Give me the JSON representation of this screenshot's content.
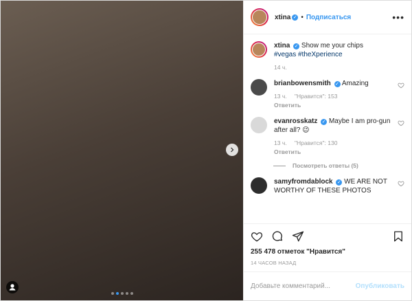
{
  "header": {
    "username": "xtina",
    "follow_label": "Подписаться",
    "separator": "•",
    "more_label": "•••"
  },
  "media": {
    "note": "",
    "slide_count": 5,
    "active_slide": 2
  },
  "caption": {
    "username": "xtina",
    "text": "Show me your chips",
    "hashtags": "#vegas #theXperience",
    "time": "14 ч."
  },
  "comments": [
    {
      "username": "brianbowensmith",
      "verified": true,
      "text": "Amazing",
      "time": "13 ч.",
      "likes": "\"Нравится\": 153",
      "reply_label": "Ответить"
    },
    {
      "username": "evanrosskatz",
      "verified": true,
      "text": "Maybe I am pro-gun after all? 😉",
      "time": "13 ч.",
      "likes": "\"Нравится\": 130",
      "reply_label": "Ответить"
    },
    {
      "username": "samyfromdablock",
      "verified": true,
      "text": "WE ARE NOT WORTHY OF THESE PHOTOS",
      "time": "",
      "likes": "",
      "reply_label": ""
    }
  ],
  "view_replies": "Посмотреть ответы (5)",
  "likes_text": "255 478 отметок \"Нравится\"",
  "posted_time": "14 ЧАСОВ НАЗАД",
  "add_comment": {
    "placeholder": "Добавьте комментарий...",
    "publish_label": "Опубликовать"
  },
  "colors": {
    "accent": "#3897f0",
    "text": "#262626",
    "muted": "#999999"
  }
}
